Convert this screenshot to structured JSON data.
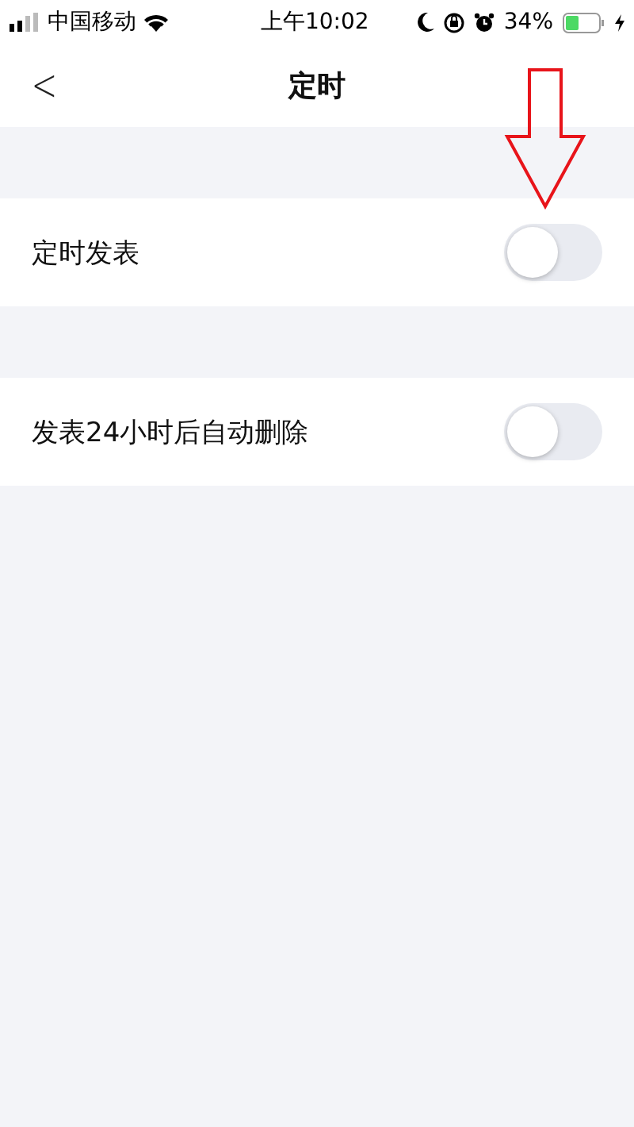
{
  "status_bar": {
    "carrier": "中国移动",
    "time": "上午10:02",
    "battery": "34%"
  },
  "nav": {
    "back": "<",
    "title": "定时"
  },
  "settings": [
    {
      "label": "定时发表",
      "on": false
    },
    {
      "label": "发表24小时后自动删除",
      "on": false
    }
  ]
}
